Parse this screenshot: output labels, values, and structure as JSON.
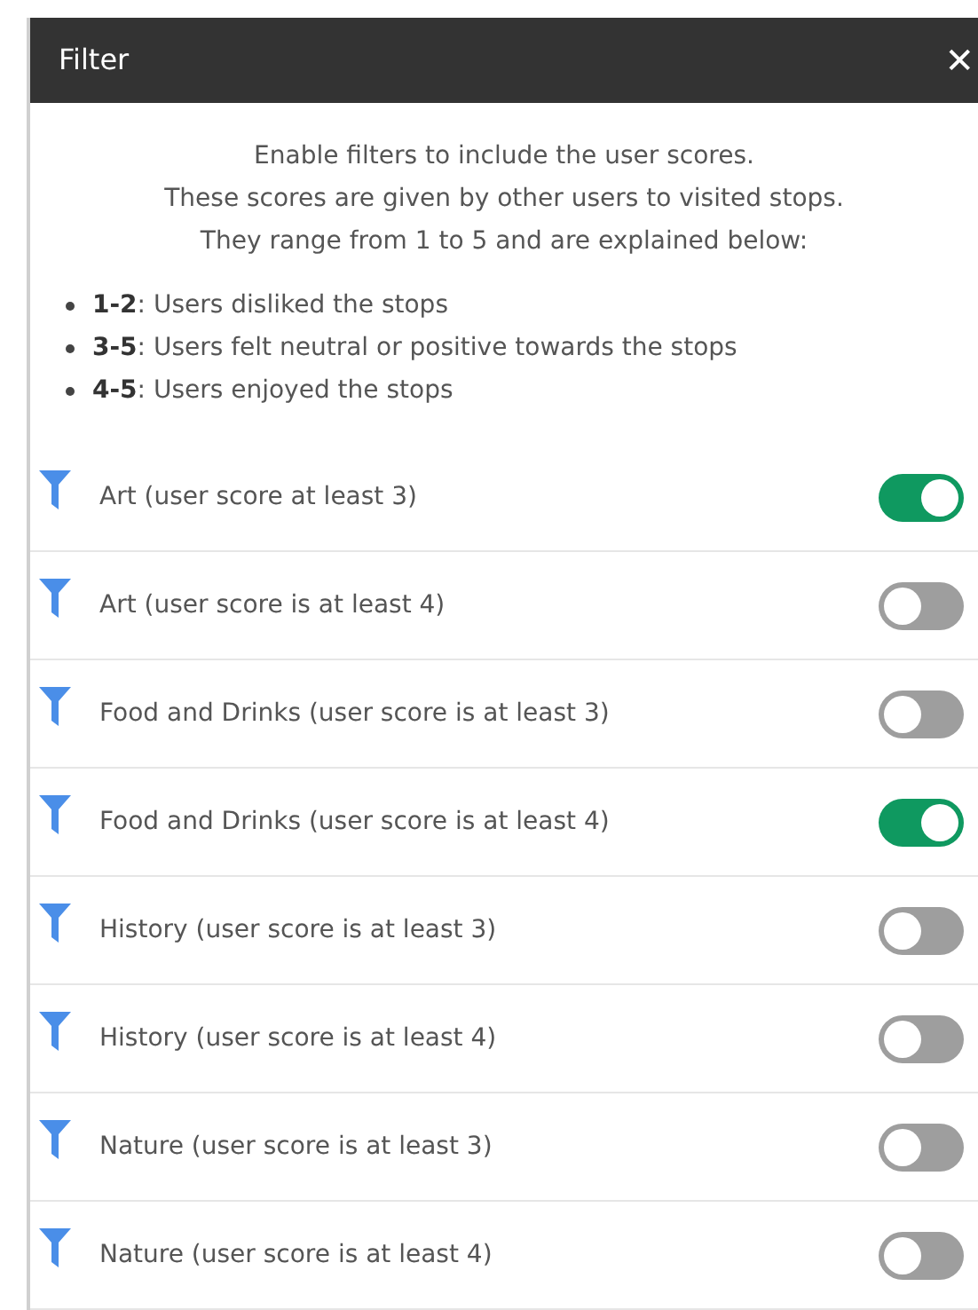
{
  "dialog": {
    "title": "Filter",
    "close": "✕"
  },
  "intro": [
    "Enable filters to include the user scores.",
    "These scores are given by other users to visited stops.",
    "They range from 1 to 5 and are explained below:"
  ],
  "legend": [
    "**1-2**: Users disliked the stops",
    "**3-5**: Users felt neutral or positive towards the stops",
    "**4-5**: Users enjoyed the stops"
  ],
  "filters": [
    {
      "label": "Art (user score at least 3)",
      "on": true
    },
    {
      "label": "Art (user score is at least 4)",
      "on": false
    },
    {
      "label": "Food and Drinks (user score is at least 3)",
      "on": false
    },
    {
      "label": "Food and Drinks (user score is at least 4)",
      "on": true
    },
    {
      "label": "History (user score is at least 3)",
      "on": false
    },
    {
      "label": "History (user score is at least 4)",
      "on": false
    },
    {
      "label": "Nature (user score is at least 3)",
      "on": false
    },
    {
      "label": "Nature (user score is at least 4)",
      "on": false
    }
  ]
}
